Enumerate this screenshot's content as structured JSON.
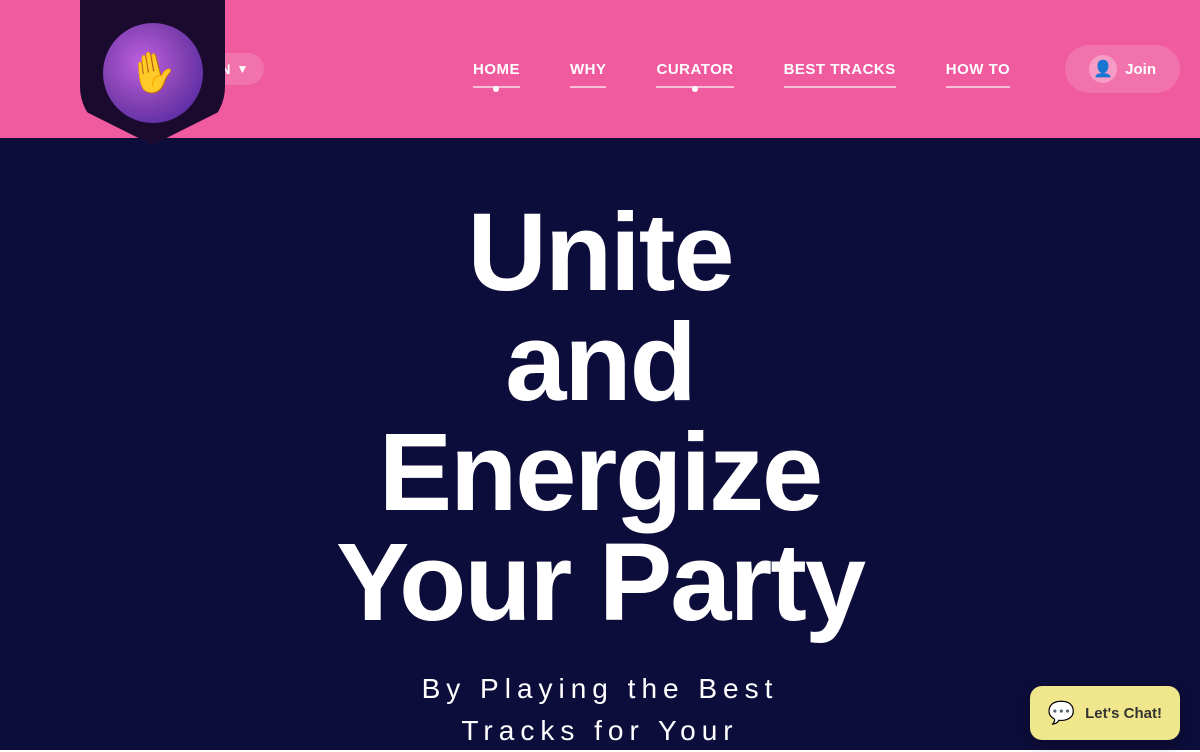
{
  "header": {
    "logo_alt": "Party DJ Logo",
    "lang_label": "EN",
    "nav_items": [
      {
        "label": "HOME",
        "active": true
      },
      {
        "label": "WHY",
        "active": false
      },
      {
        "label": "CURATOR",
        "active": true
      },
      {
        "label": "BEST TRACKS",
        "active": false
      },
      {
        "label": "HOW TO",
        "active": false
      }
    ],
    "join_label": "Join"
  },
  "hero": {
    "line1": "Unite",
    "line2": "and",
    "line3": "Energize",
    "line4": "Your Party",
    "subtitle_line1": "By Playing the Best",
    "subtitle_line2": "Tracks for Your"
  },
  "chat": {
    "label": "Let's Chat!"
  },
  "colors": {
    "header_bg": "#f05a9e",
    "main_bg": "#0d0d3b",
    "chat_bg": "#f0e68c"
  }
}
